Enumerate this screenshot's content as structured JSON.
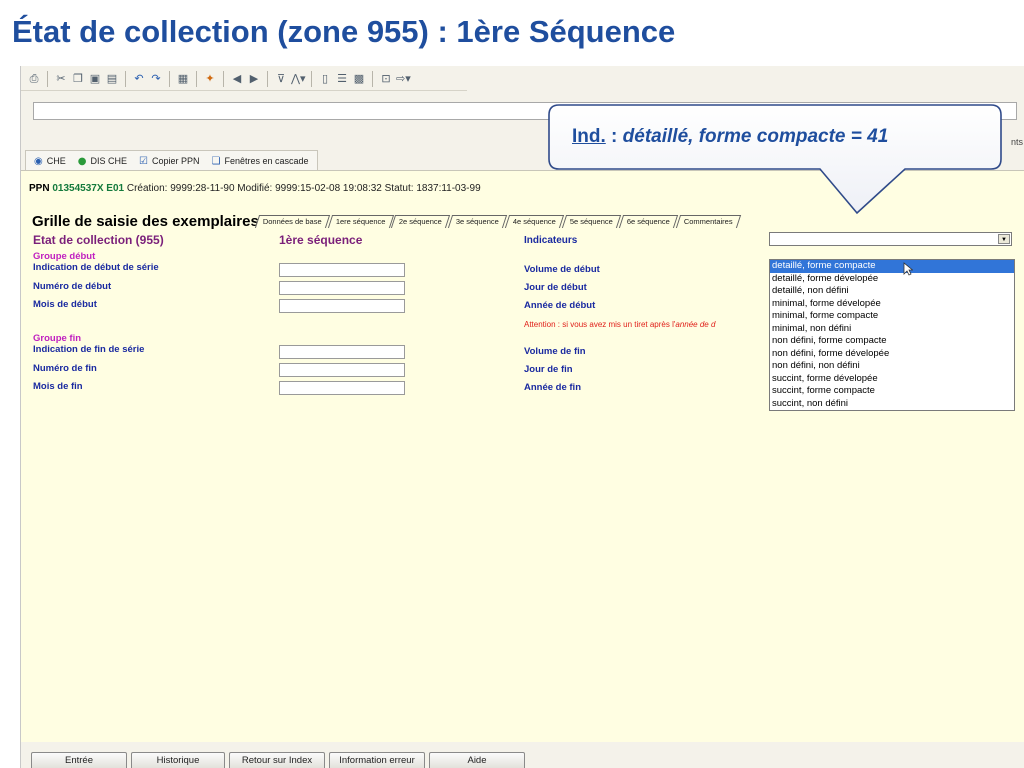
{
  "slide": {
    "title": "État de collection (zone 955) :  1ère Séquence"
  },
  "right_edge": "nts",
  "linkbar": {
    "items": [
      {
        "label": "CHE",
        "icon": "info-circle-icon"
      },
      {
        "label": "DIS CHE",
        "icon": "globe-icon"
      },
      {
        "label": "Copier PPN",
        "icon": "copy-check-icon"
      },
      {
        "label": "Fenêtres en cascade",
        "icon": "cascade-windows-icon"
      }
    ]
  },
  "record": {
    "ppn_label": "PPN",
    "ppn_value": "01354537X E01",
    "meta": "Création: 9999:28-11-90 Modifié: 9999:15-02-08 19:08:32 Statut: 1837:11-03-99"
  },
  "grille_title": "Grille de saisie des exemplaires",
  "tabs": [
    "Données de base",
    "1ere séquence",
    "2e séquence",
    "3e séquence",
    "4e séquence",
    "5e séquence",
    "6e séquence",
    "Commentaires"
  ],
  "headers": {
    "etat": "Etat de collection (955)",
    "sequence": "1ère séquence",
    "indicateurs": "Indicateurs"
  },
  "groups": {
    "debut": "Groupe début",
    "fin": "Groupe fin"
  },
  "labels": {
    "indication_debut": "Indication de début de série",
    "numero_debut": "Numéro de début",
    "mois_debut": "Mois de début",
    "volume_debut": "Volume de début",
    "jour_debut": "Jour de début",
    "annee_debut": "Année de début",
    "indication_fin": "Indication de fin de série",
    "numero_fin": "Numéro de fin",
    "mois_fin": "Mois de fin",
    "volume_fin": "Volume de fin",
    "jour_fin": "Jour de fin",
    "annee_fin": "Année de fin"
  },
  "warning": {
    "text": "Attention : si vous avez mis un tiret après l'",
    "italic": "année de d"
  },
  "indicateurs_select": {
    "value": "",
    "options": [
      "detaillé, forme compacte",
      "detaillé, forme dévelopée",
      "detaillé, non défini",
      "minimal, forme dévelopée",
      "minimal, forme compacte",
      "minimal, non défini",
      "non défini, forme compacte",
      "non défini, forme dévelopée",
      "non défini, non défini",
      "succint, forme dévelopée",
      "succint, forme compacte",
      "succint, non défini"
    ],
    "highlighted_index": 0
  },
  "bottom_buttons": [
    "Entrée",
    "Historique",
    "Retour sur Index",
    "Information erreur",
    "Aide"
  ],
  "callout": {
    "ind": "Ind.",
    "sep": " : ",
    "text": "détaillé, forme compacte = 41"
  },
  "colors": {
    "title": "#1f4e9e",
    "form_bg": "#fffee2",
    "label_blue": "#1a2aa0",
    "header_purple": "#7a1f7a",
    "group_magenta": "#c020c0",
    "warning_red": "#e0201a",
    "ppn_green": "#147a3c",
    "selection_blue": "#3175d8"
  }
}
